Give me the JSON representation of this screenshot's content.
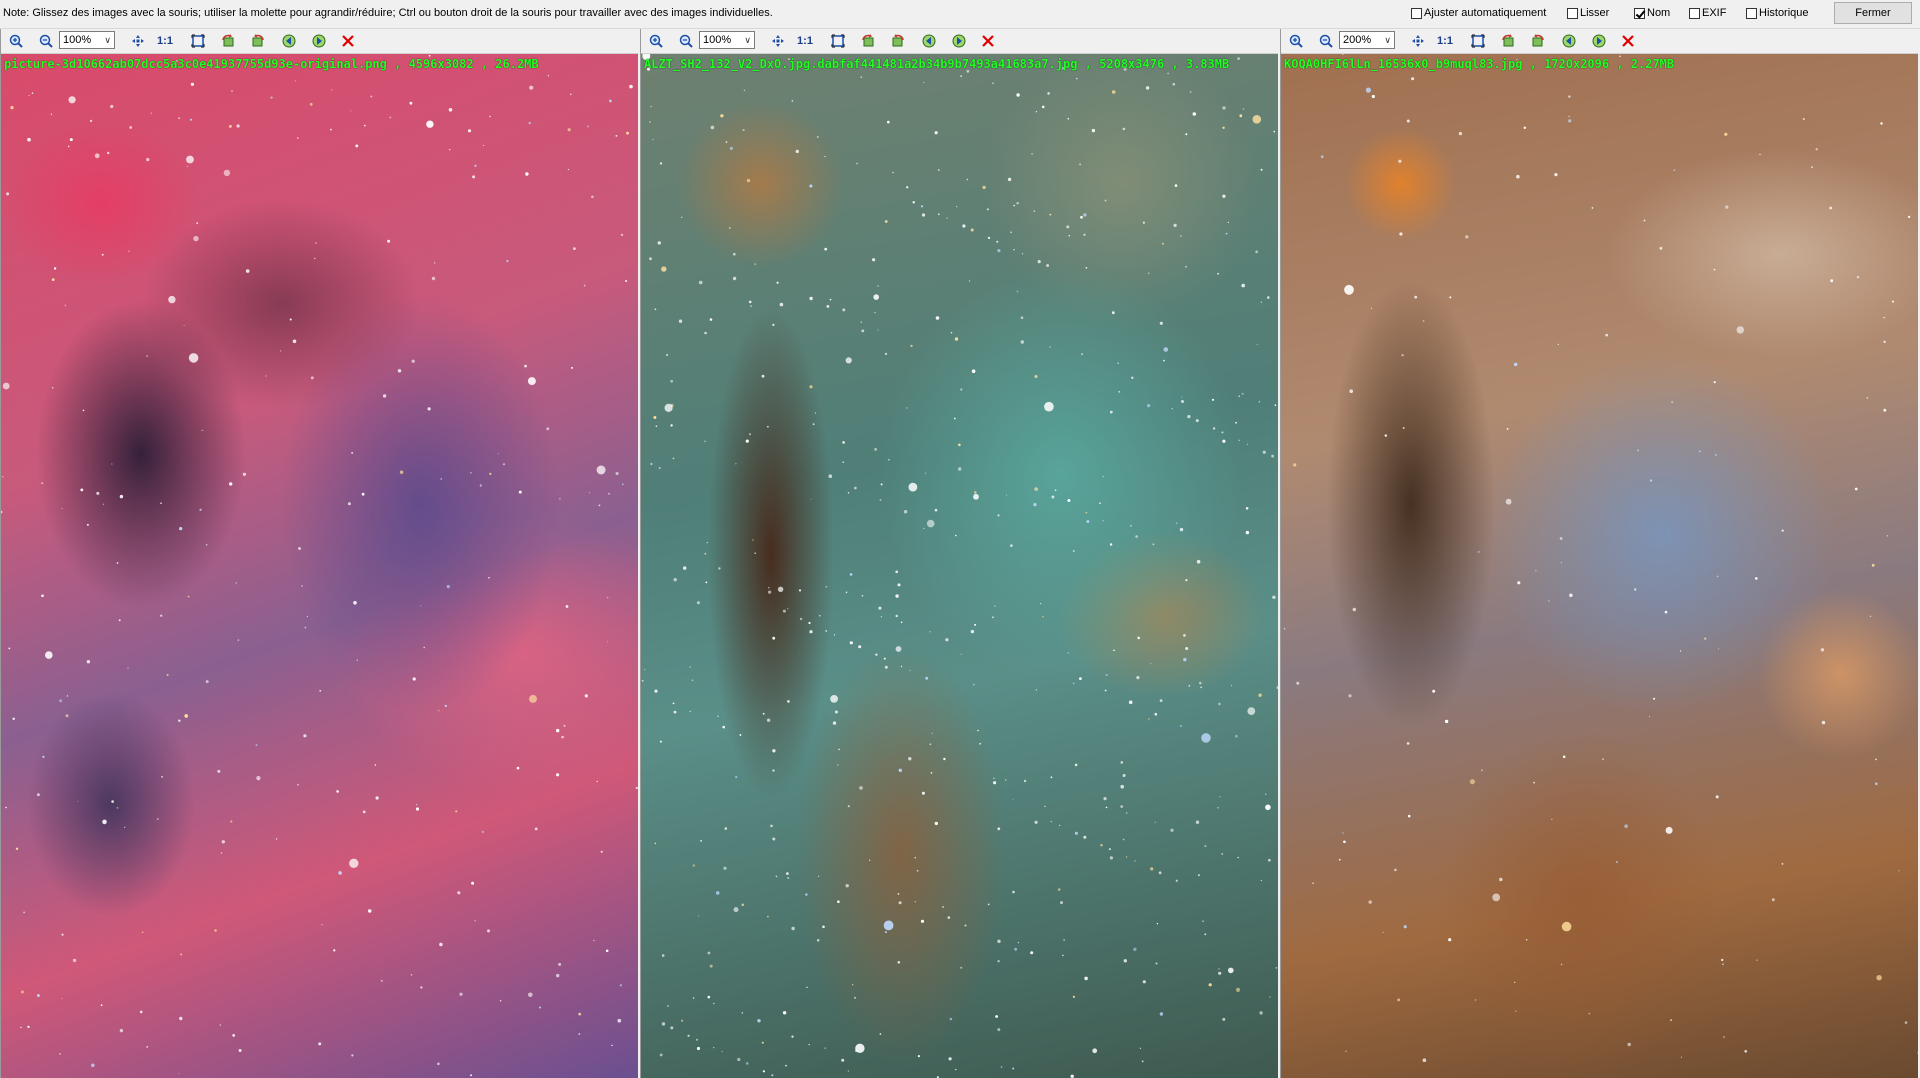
{
  "topbar": {
    "note": "Note: Glissez des images avec la souris; utiliser la molette pour agrandir/réduire; Ctrl ou bouton droit de la souris pour travailler avec des images individuelles.",
    "options": [
      {
        "label": "Ajuster automatiquement",
        "checked": false
      },
      {
        "label": "Lisser",
        "checked": false
      },
      {
        "label": "Nom",
        "checked": true
      },
      {
        "label": "EXIF",
        "checked": false
      },
      {
        "label": "Historique",
        "checked": false
      }
    ],
    "close_label": "Fermer"
  },
  "panels": [
    {
      "zoom": "100%",
      "one_to_one": "1:1",
      "caption": "picture-3d10662ab07dcc5a3c0e41937755d93e-original.png , 4596x3082 , 26.2MB"
    },
    {
      "zoom": "100%",
      "one_to_one": "1:1",
      "caption": "ALZT_SH2_132_V2_DxO.jpg.dabfaf441481a2b34b9b7493a41683a7.jpg , 5208x3476 , 3.83MB"
    },
    {
      "zoom": "200%",
      "one_to_one": "1:1",
      "caption": "KOQA0HFI6lLn_16536x0_b9muql83.jpg , 1720x2096 , 2.27MB"
    }
  ],
  "colors": {
    "caption": "#22ff22",
    "delete": "#e00000",
    "accent": "#1a3c8a"
  }
}
